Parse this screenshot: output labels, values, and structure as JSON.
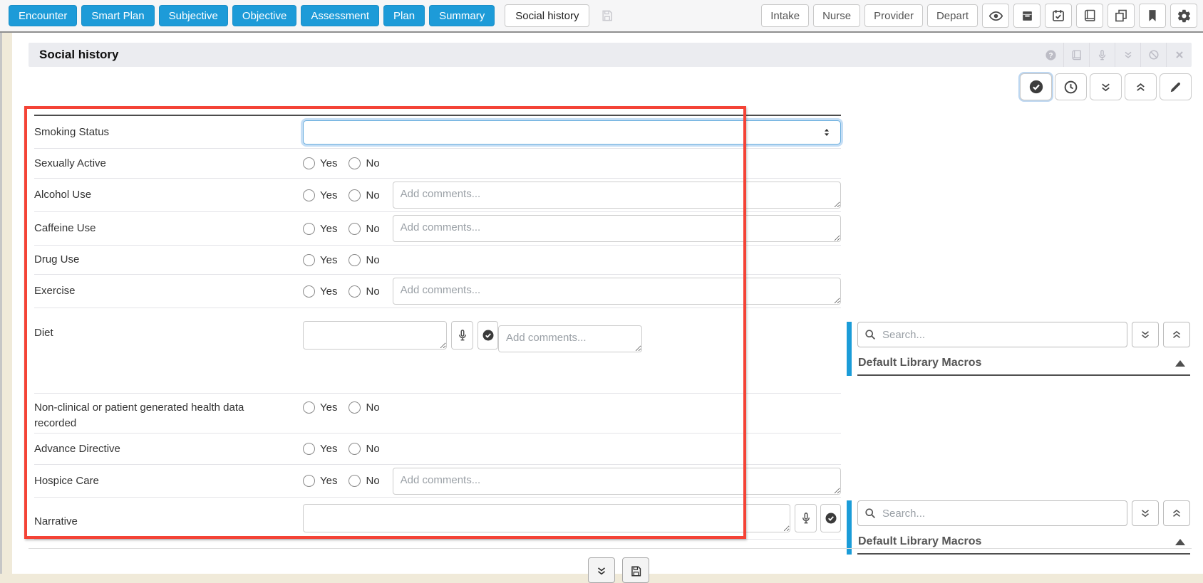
{
  "topbar": {
    "nav": [
      "Encounter",
      "Smart Plan",
      "Subjective",
      "Objective",
      "Assessment",
      "Plan",
      "Summary"
    ],
    "active_tab": "Social history",
    "right_nav": [
      "Intake",
      "Nurse",
      "Provider",
      "Depart"
    ],
    "icons": [
      "save",
      "eye",
      "archive-box",
      "calendar-check",
      "book",
      "copy",
      "bookmark",
      "settings"
    ]
  },
  "section": {
    "title": "Social history",
    "header_icons": [
      "help",
      "book",
      "microphone",
      "collapse-all",
      "disable",
      "close"
    ],
    "action_icons": [
      "complete-check",
      "history-clock",
      "expand-all-down",
      "collapse-all-up",
      "edit-pencil"
    ]
  },
  "form": {
    "yes_label": "Yes",
    "no_label": "No",
    "comments_placeholder": "Add comments...",
    "rows": [
      {
        "label": "Smoking Status",
        "control": "select"
      },
      {
        "label": "Sexually Active",
        "control": "yes-no"
      },
      {
        "label": "Alcohol Use",
        "control": "yes-no-comments"
      },
      {
        "label": "Caffeine Use",
        "control": "yes-no-comments"
      },
      {
        "label": "Drug Use",
        "control": "yes-no"
      },
      {
        "label": "Exercise",
        "control": "yes-no-comments"
      },
      {
        "label": "Diet",
        "control": "text-mic-check-comments"
      },
      {
        "label": "Non-clinical or patient generated health data recorded",
        "control": "yes-no"
      },
      {
        "label": "Advance Directive",
        "control": "yes-no"
      },
      {
        "label": "Hospice Care",
        "control": "yes-no-comments"
      },
      {
        "label": "Narrative",
        "control": "text-mic-check"
      }
    ]
  },
  "macros": {
    "search_placeholder": "Search...",
    "title": "Default Library Macros"
  },
  "footer": {
    "icons": [
      "expand-all-down",
      "save"
    ]
  },
  "colors": {
    "accent_blue": "#1b9cd8",
    "annotation_red": "#f44336"
  }
}
